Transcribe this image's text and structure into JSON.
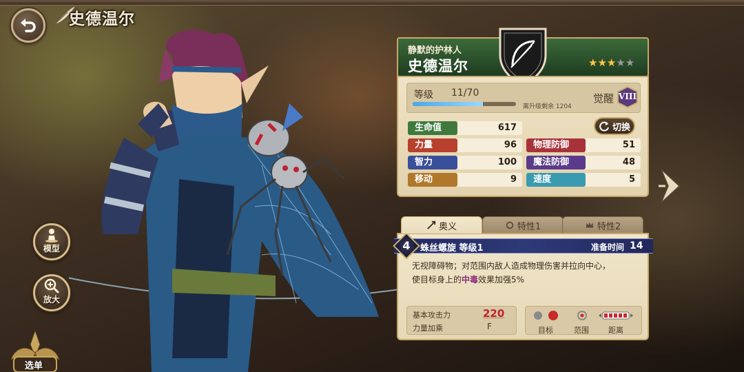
{
  "header": {
    "title": "史德温尔"
  },
  "left_buttons": {
    "model": "模型",
    "zoom": "放大",
    "select": "选单"
  },
  "card": {
    "subtitle": "静默的护林人",
    "name": "史德温尔",
    "stars_filled": 3,
    "stars_total": 5,
    "level_label": "等级",
    "level_value": "11/70",
    "level_progress": 0.68,
    "exp_text": "离升级剩余 1204",
    "awaken_label": "觉醒",
    "awaken_value": "VIII",
    "switch_label": "切换",
    "stats": {
      "hp": {
        "label": "生命值",
        "value": "617"
      },
      "str": {
        "label": "力量",
        "value": "96"
      },
      "int": {
        "label": "智力",
        "value": "100"
      },
      "move": {
        "label": "移动",
        "value": "9"
      },
      "pdef": {
        "label": "物理防御",
        "value": "51"
      },
      "mdef": {
        "label": "魔法防御",
        "value": "48"
      },
      "speed": {
        "label": "速度",
        "value": "5"
      }
    },
    "colors": {
      "hp": "#3f7a3c",
      "str": "#b8402e",
      "int": "#3a4f9a",
      "move": "#b0782a",
      "pdef": "#a8323a",
      "mdef": "#5a3a8a",
      "speed": "#3a9ab0"
    }
  },
  "skill": {
    "tabs": [
      "奥义",
      "特性1",
      "特性2"
    ],
    "number": "4",
    "name": "蛛丝螺旋 等级1",
    "prep_label": "准备时间",
    "prep_value": "14",
    "desc_1": "无视障碍物；对范围内敌人造成物理伤害并拉向中心，",
    "desc_2a": "使目标身上的",
    "desc_2b": "中毒",
    "desc_2c": "效果加强5%",
    "base_atk_label": "基本攻击力",
    "base_atk_value": "220",
    "str_mult_label": "力量加乘",
    "str_mult_value": "F",
    "target_label": "目标",
    "range_label": "范围",
    "distance_label": "距离"
  }
}
